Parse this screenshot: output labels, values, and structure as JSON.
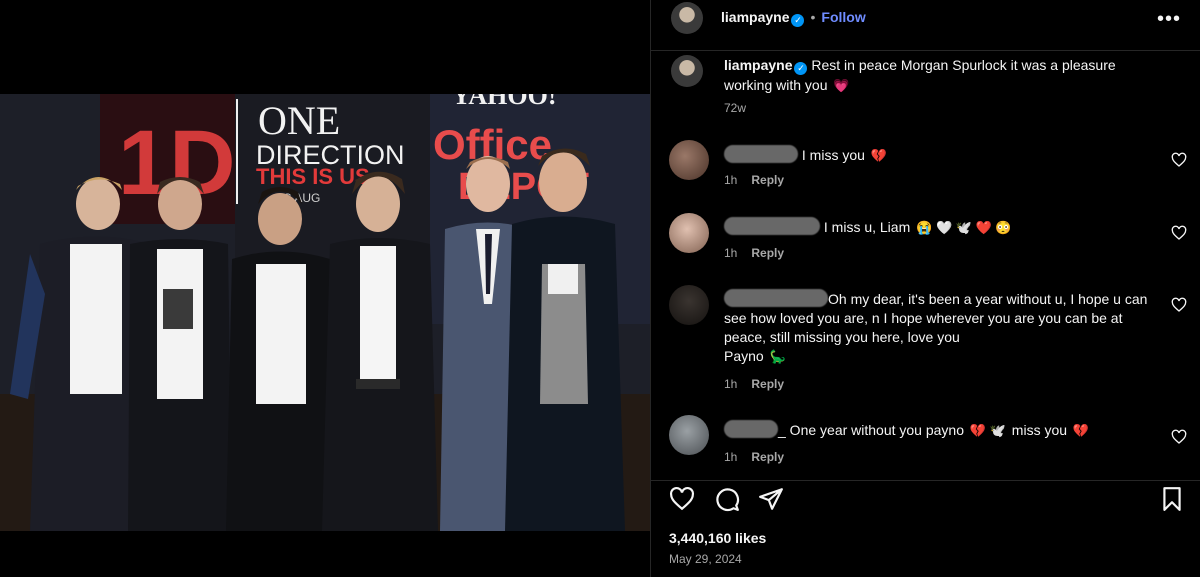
{
  "post": {
    "username": "liampayne",
    "follow_label": "Follow",
    "separator": "•",
    "more_label": "•••",
    "caption": "Rest in peace Morgan Spurlock it was a pleasure working with you",
    "caption_emoji": "💗",
    "caption_time": "72w",
    "likes": "3,440,160 likes",
    "date": "May 29, 2024"
  },
  "photo": {
    "banner_logo": "1D",
    "banner_line1": "ONE",
    "banner_line2": "DIRECTION",
    "banner_line3": "THIS IS US",
    "banner_line4": "RS AUG",
    "sponsor_top": "YAHOO!",
    "sponsor_main1": "Office",
    "sponsor_main2": "DEPOT"
  },
  "comments": [
    {
      "text": "I miss you",
      "emoji": "💔",
      "time": "1h",
      "reply": "Reply",
      "avatar_color": "#7a5a4a"
    },
    {
      "text": "I miss u, Liam",
      "emoji": "😭 🤍 🕊️ ❤️ 😳",
      "time": "1h",
      "reply": "Reply",
      "avatar_color": "#b08878"
    },
    {
      "text": "Oh my dear, it's been a year without u, I hope u can see how loved you are, n I hope wherever you are you can be at peace, still missing you here, love you",
      "text2": "Payno",
      "emoji": "🦕",
      "time": "1h",
      "reply": "Reply",
      "avatar_color": "#2a2624"
    },
    {
      "text": "_ One year without you payno",
      "emoji": "💔 🕊️",
      "text_b": "miss you",
      "emoji_b": "💔",
      "time": "1h",
      "reply": "Reply",
      "avatar_color": "#6a6e74"
    }
  ]
}
